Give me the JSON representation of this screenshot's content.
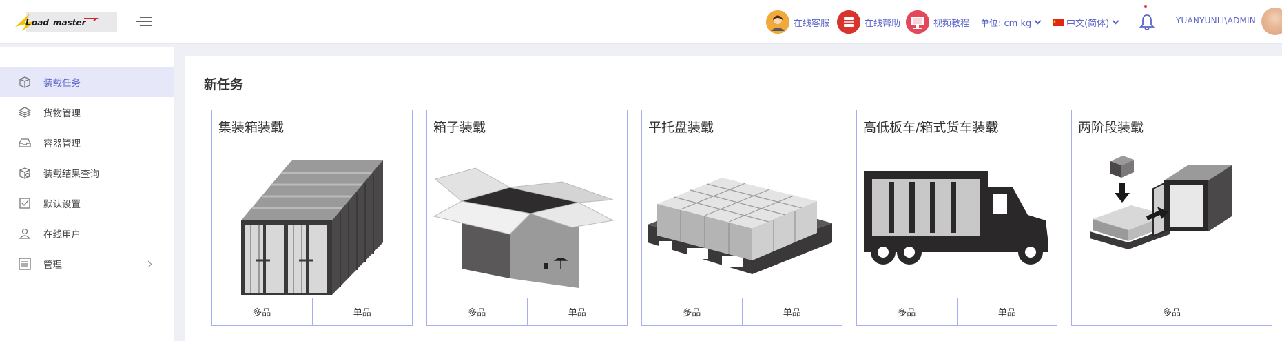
{
  "header": {
    "logo_text": "Loadmaster",
    "online_service": "在线客服",
    "online_help": "在线帮助",
    "video_tutorial": "视频教程",
    "unit_label": "单位: cm kg",
    "language_label": "中文(简体)",
    "username": "YUANYUNLI\\ADMIN"
  },
  "sidebar": {
    "items": [
      {
        "label": "装载任务",
        "icon": "box-icon"
      },
      {
        "label": "货物管理",
        "icon": "layers-icon"
      },
      {
        "label": "容器管理",
        "icon": "inbox-icon"
      },
      {
        "label": "装载结果查询",
        "icon": "box-search-icon"
      },
      {
        "label": "默认设置",
        "icon": "checkbox-icon"
      },
      {
        "label": "在线用户",
        "icon": "user-icon"
      },
      {
        "label": "管理",
        "icon": "sliders-icon"
      }
    ]
  },
  "main": {
    "title": "新任务",
    "cards": [
      {
        "title": "集装箱装载",
        "buttons": [
          "多品",
          "单品"
        ]
      },
      {
        "title": "箱子装载",
        "buttons": [
          "多品",
          "单品"
        ]
      },
      {
        "title": "平托盘装载",
        "buttons": [
          "多品",
          "单品"
        ]
      },
      {
        "title": "高低板车/箱式货车装载",
        "buttons": [
          "多品",
          "单品"
        ]
      },
      {
        "title": "两阶段装载",
        "buttons": [
          "多品"
        ]
      }
    ]
  },
  "colors": {
    "accent": "#5a64c8",
    "sidebar_active_bg": "#e6e8fa",
    "card_border": "#a9aef0",
    "page_bg": "#eef0f6"
  }
}
